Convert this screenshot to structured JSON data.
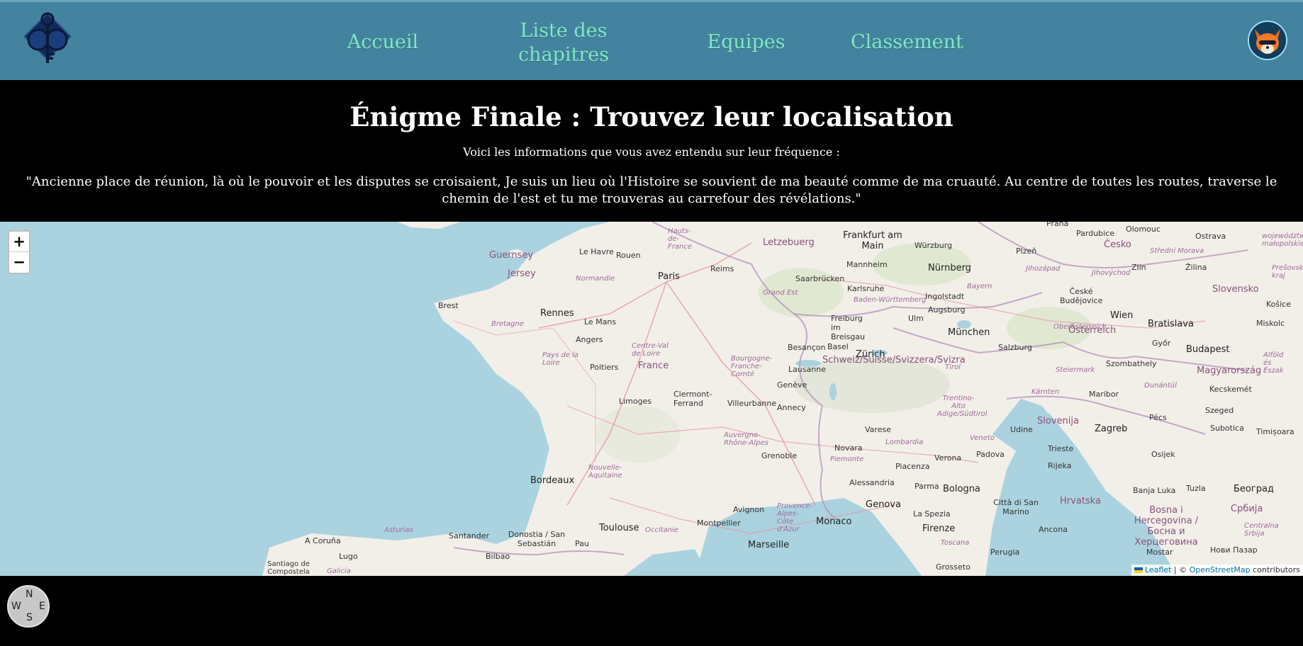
{
  "nav": {
    "home": "Accueil",
    "chapters": "Liste des chapitres",
    "teams": "Equipes",
    "ranking": "Classement"
  },
  "page": {
    "title": "Énigme Finale : Trouvez leur localisation",
    "intro": "Voici les informations que vous avez entendu sur leur fréquence :",
    "riddle": "\"Ancienne place de réunion, là où le pouvoir et les disputes se croisaient, Je suis un lieu où l'Histoire se souvient de ma beauté comme de ma cruauté. Au centre de toutes les routes, traverse le chemin de l'est et tu me trouveras au carrefour des révélations.\""
  },
  "map": {
    "zoom_in": "+",
    "zoom_out": "−",
    "attribution_leaflet": "Leaflet",
    "attribution_sep": " | © ",
    "attribution_osm": "OpenStreetMap",
    "attribution_tail": " contributors",
    "cities": [
      {
        "name": "Paris",
        "big": true
      },
      {
        "name": "Le Havre"
      },
      {
        "name": "Rouen"
      },
      {
        "name": "Reims"
      },
      {
        "name": "Brest"
      },
      {
        "name": "Rennes",
        "big": true
      },
      {
        "name": "Le Mans"
      },
      {
        "name": "Angers"
      },
      {
        "name": "Poitiers"
      },
      {
        "name": "Limoges"
      },
      {
        "name": "Clermont-Ferrand"
      },
      {
        "name": "Villeurbanne"
      },
      {
        "name": "Annecy"
      },
      {
        "name": "Genève"
      },
      {
        "name": "Lausanne"
      },
      {
        "name": "Besançon"
      },
      {
        "name": "Bordeaux",
        "big": true
      },
      {
        "name": "Toulouse",
        "big": true
      },
      {
        "name": "Montpellier"
      },
      {
        "name": "Marseille",
        "big": true
      },
      {
        "name": "Avignon"
      },
      {
        "name": "Grenoble"
      },
      {
        "name": "Monaco",
        "big": true
      },
      {
        "name": "Genova",
        "big": true
      },
      {
        "name": "Alessandria"
      },
      {
        "name": "Novara"
      },
      {
        "name": "Varese"
      },
      {
        "name": "Piacenza"
      },
      {
        "name": "Verona"
      },
      {
        "name": "Padova"
      },
      {
        "name": "Bologna",
        "big": true
      },
      {
        "name": "Parma"
      },
      {
        "name": "La Spezia"
      },
      {
        "name": "Firenze",
        "big": true
      },
      {
        "name": "Città di San Marino"
      },
      {
        "name": "Ancona"
      },
      {
        "name": "Perugia"
      },
      {
        "name": "Grosseto"
      },
      {
        "name": "Udine"
      },
      {
        "name": "Trieste"
      },
      {
        "name": "Rijeka"
      },
      {
        "name": "Zagreb",
        "big": true
      },
      {
        "name": "Pécs"
      },
      {
        "name": "Szeged"
      },
      {
        "name": "Timișoara"
      },
      {
        "name": "Kecskemét"
      },
      {
        "name": "Budapest",
        "big": true
      },
      {
        "name": "Győr"
      },
      {
        "name": "Bratislava",
        "big": true
      },
      {
        "name": "Wien",
        "big": true
      },
      {
        "name": "Zlín"
      },
      {
        "name": "Žilina"
      },
      {
        "name": "Plzeň"
      },
      {
        "name": "Praha"
      },
      {
        "name": "Pardubice"
      },
      {
        "name": "Ostrava"
      },
      {
        "name": "Olomouc"
      },
      {
        "name": "Košice"
      },
      {
        "name": "Miskolc"
      },
      {
        "name": "Frankfurt am Main",
        "big": true
      },
      {
        "name": "Würzburg"
      },
      {
        "name": "Nürnberg",
        "big": true
      },
      {
        "name": "Mannheim"
      },
      {
        "name": "Saarbrücken"
      },
      {
        "name": "Karlsruhe"
      },
      {
        "name": "Ingolstadt"
      },
      {
        "name": "Augsburg"
      },
      {
        "name": "Ulm"
      },
      {
        "name": "München",
        "big": true
      },
      {
        "name": "Freiburg im Breisgau"
      },
      {
        "name": "Basel"
      },
      {
        "name": "Zürich",
        "big": true
      },
      {
        "name": "Salzburg"
      },
      {
        "name": "Szombathely"
      },
      {
        "name": "Maribor"
      },
      {
        "name": "Osijek"
      },
      {
        "name": "Banja Luka"
      },
      {
        "name": "Tuzla"
      },
      {
        "name": "Београд",
        "big": true
      },
      {
        "name": "Mostar"
      },
      {
        "name": "Нови Пазар"
      },
      {
        "name": "Santander"
      },
      {
        "name": "Donostia / San Sebastián"
      },
      {
        "name": "Bilbao"
      },
      {
        "name": "Pau"
      },
      {
        "name": "Lugo"
      },
      {
        "name": "A Coruña"
      },
      {
        "name": "Santiago de Compostela"
      },
      {
        "name": "České Budějovice"
      },
      {
        "name": "Subotica"
      }
    ],
    "regions": [
      "Hauts-de-France",
      "Normandie",
      "Bretagne",
      "Pays de la Loire",
      "Centre-Val de Loire",
      "Bourgogne-Franche-Comté",
      "Grand Est",
      "Nouvelle-Aquitaine",
      "Auvergne-Rhône-Alpes",
      "Occitanie",
      "Provence-Alpes-Côte d'Azur",
      "Piemonte",
      "Lombardia",
      "Veneto",
      "Trentino-Alto Adige/Südtirol",
      "Toscana",
      "Baden-Württemberg",
      "Bayern",
      "Jihozápad",
      "Jihovýchod",
      "Střední Morava",
      "Oberösterreich",
      "Steiermark",
      "Kärnten",
      "Tirol",
      "Dunántúl",
      "Galicia",
      "Asturias",
      "Centralna Srbija",
      "województwo małopolskie",
      "Prešovský kraj",
      "Alföld és Észak"
    ],
    "countries": [
      "France",
      "Letzebuerg",
      "Schweiz/Suisse/Svizzera/Svizra",
      "Österreich",
      "Magyarország",
      "Slovensko",
      "Česko",
      "Slovenija",
      "Hrvatska",
      "Bosna i Hercegovina / Босна и Херцеговина",
      "Србија",
      "Guernsey",
      "Jersey"
    ]
  },
  "compass": {
    "n": "N",
    "s": "S",
    "e": "E",
    "w": "W"
  }
}
